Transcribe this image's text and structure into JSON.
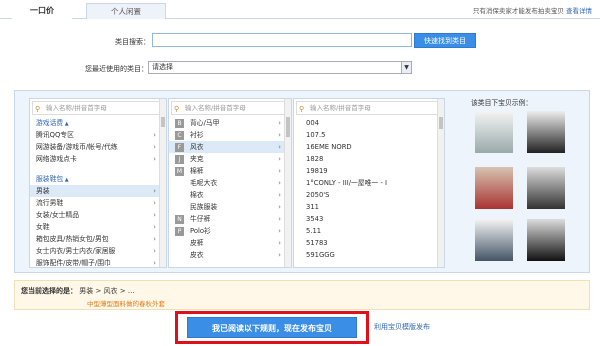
{
  "tabs": {
    "active": "一口价",
    "inactive": "个人闲置"
  },
  "top_note": {
    "text": "只有消保卖家才能发布拍卖宝贝",
    "link": "查看详情"
  },
  "category_search": {
    "label": "类目搜索：",
    "value": "",
    "button": "快速找到类目"
  },
  "recent": {
    "label": "您最近使用的类目：",
    "value": "请选择"
  },
  "columns": {
    "placeholder": "输入名称/拼音首字母",
    "col1": [
      {
        "text": "游戏话费",
        "group": true
      },
      {
        "text": "腾讯QQ专区",
        "chev": true
      },
      {
        "text": "网游装备/游戏币/帐号/代练",
        "chev": true
      },
      {
        "text": "网络游戏点卡",
        "chev": true
      },
      {
        "text": "",
        "spacer": true
      },
      {
        "text": "服装鞋包",
        "group": true
      },
      {
        "text": "男装",
        "chev": true,
        "sel": true
      },
      {
        "text": "流行男鞋",
        "chev": true
      },
      {
        "text": "女装/女士精品",
        "chev": true
      },
      {
        "text": "女鞋",
        "chev": true
      },
      {
        "text": "箱包皮具/热销女包/男包",
        "chev": true
      },
      {
        "text": "女士内衣/男士内衣/家居服",
        "chev": true
      },
      {
        "text": "服饰配件/皮带/帽子/围巾",
        "chev": true
      }
    ],
    "col2": [
      {
        "letter": "B",
        "text": "背心/马甲",
        "chev": true
      },
      {
        "letter": "C",
        "text": "衬衫",
        "chev": true
      },
      {
        "letter": "F",
        "text": "风衣",
        "chev": true,
        "sel": true
      },
      {
        "letter": "J",
        "text": "夹克",
        "chev": true
      },
      {
        "letter": "M",
        "text": "棉裤",
        "chev": true
      },
      {
        "letter": "",
        "text": "毛呢大衣",
        "chev": true
      },
      {
        "letter": "",
        "text": "棉衣",
        "chev": true
      },
      {
        "letter": "",
        "text": "民族服装",
        "chev": true
      },
      {
        "letter": "N",
        "text": "牛仔裤",
        "chev": true
      },
      {
        "letter": "P",
        "text": "Polo衫",
        "chev": true
      },
      {
        "letter": "",
        "text": "皮裤",
        "chev": true
      },
      {
        "letter": "",
        "text": "皮衣",
        "chev": true
      }
    ],
    "col3": [
      "004",
      "107.5",
      "16EME NORD",
      "1828",
      "19819",
      "1°CONLY - III/一屋唯一 - I",
      "2050'S",
      "311",
      "3543",
      "5.11",
      "51783",
      "591GGG"
    ]
  },
  "samples_title": "该类目下宝贝示例：",
  "selection": {
    "label": "您当前选择的是：",
    "path": "男装 > 风衣 > ...",
    "hint": "中型薄型面料做的春秋外套"
  },
  "submit": {
    "label": "我已阅读以下规则，现在发布宝贝"
  },
  "template_link": "利用宝贝模版发布",
  "colors": {
    "accent": "#3a8ee6",
    "highlight": "#e0101a",
    "link": "#3068b4"
  }
}
